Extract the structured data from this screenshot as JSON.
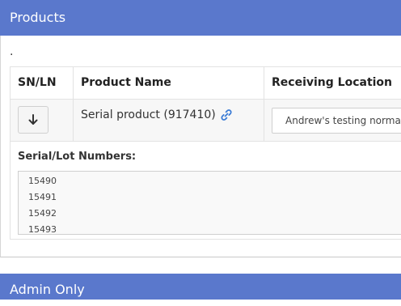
{
  "products_panel": {
    "title": "Products",
    "dot": "."
  },
  "table": {
    "headers": {
      "sn_ln": "SN/LN",
      "product_name": "Product Name",
      "receiving_location": "Receiving Location"
    },
    "row": {
      "product_name": "Serial product (917410)",
      "receiving_location": "Andrew's testing normal"
    }
  },
  "serials": {
    "label": "Serial/Lot Numbers:",
    "values": [
      "15490",
      "15491",
      "15492",
      "15493"
    ]
  },
  "admin_panel": {
    "title": "Admin Only"
  },
  "colors": {
    "header_bg": "#5a78cc",
    "link_icon": "#3a7bd5"
  },
  "icons": {
    "arrow": "arrow-down-icon",
    "link": "link-icon"
  }
}
